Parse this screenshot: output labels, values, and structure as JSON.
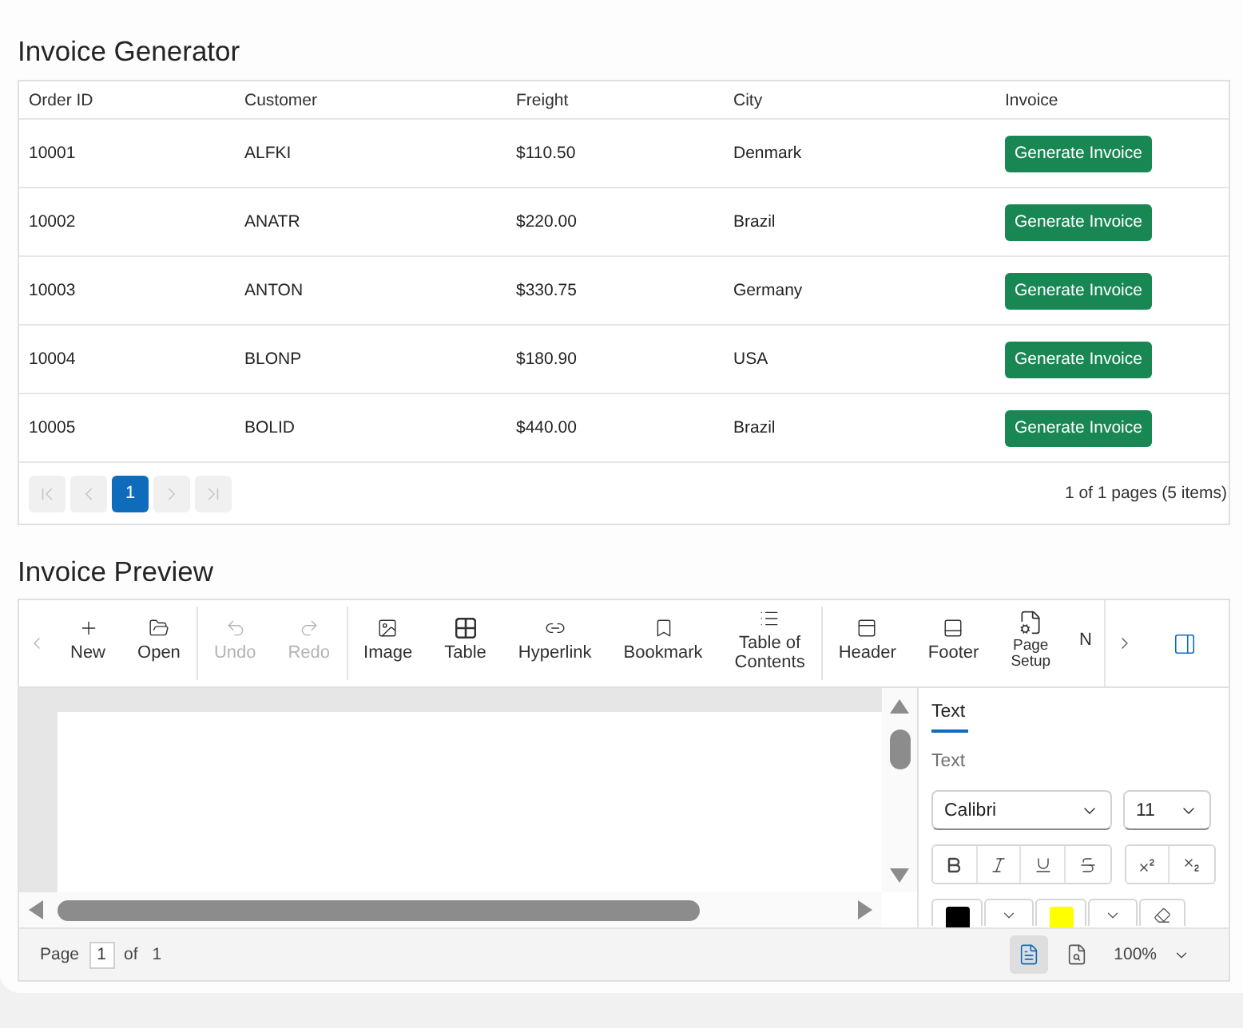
{
  "invoice_generator": {
    "title": "Invoice Generator",
    "table": {
      "columns": [
        "Order ID",
        "Customer",
        "Freight",
        "City",
        "Invoice"
      ],
      "rows": [
        {
          "cells": [
            "10001",
            "ALFKI",
            "$110.50",
            "Denmark"
          ],
          "action": "Generate Invoice"
        },
        {
          "cells": [
            "10002",
            "ANATR",
            "$220.00",
            "Brazil"
          ],
          "action": "Generate Invoice"
        },
        {
          "cells": [
            "10003",
            "ANTON",
            "$330.75",
            "Germany"
          ],
          "action": "Generate Invoice"
        },
        {
          "cells": [
            "10004",
            "BLONP",
            "$180.90",
            "USA"
          ],
          "action": "Generate Invoice"
        },
        {
          "cells": [
            "10005",
            "BOLID",
            "$440.00",
            "Brazil"
          ],
          "action": "Generate Invoice"
        }
      ]
    },
    "pager": {
      "buttons": [
        {
          "kind": "first",
          "disabled": true
        },
        {
          "kind": "prev",
          "disabled": true
        },
        {
          "kind": "page",
          "label": "1",
          "selected": true
        },
        {
          "kind": "next",
          "disabled": true
        },
        {
          "kind": "last",
          "disabled": true
        }
      ],
      "summary": "1 of 1 pages (5 items)"
    }
  },
  "invoice_preview": {
    "title": "Invoice Preview",
    "toolbar": {
      "scroll_left": {
        "disabled": true
      },
      "items": [
        {
          "kind": "new",
          "label": "New",
          "disabled": false
        },
        {
          "kind": "open",
          "label": "Open",
          "disabled": false
        },
        {
          "kind": "separator"
        },
        {
          "kind": "undo",
          "label": "Undo",
          "disabled": true
        },
        {
          "kind": "redo",
          "label": "Redo",
          "disabled": true
        },
        {
          "kind": "separator"
        },
        {
          "kind": "image",
          "label": "Image",
          "disabled": false
        },
        {
          "kind": "table",
          "label": "Table",
          "disabled": false
        },
        {
          "kind": "hyperlink",
          "label": "Hyperlink",
          "disabled": false
        },
        {
          "kind": "bookmark",
          "label": "Bookmark",
          "disabled": false
        },
        {
          "kind": "toc",
          "label": "Table of Contents",
          "disabled": false
        },
        {
          "kind": "separator"
        },
        {
          "kind": "header",
          "label": "Header",
          "disabled": false
        },
        {
          "kind": "footer",
          "label": "Footer",
          "disabled": false
        },
        {
          "kind": "page_setup",
          "label": "Page Setup",
          "disabled": false
        },
        {
          "kind": "cut",
          "label": "N",
          "disabled": false
        }
      ],
      "scroll_right": {
        "disabled": false
      }
    },
    "properties": {
      "tabs": [
        {
          "label": "Text",
          "selected": true
        }
      ],
      "section_label": "Text",
      "font_family": {
        "value": "Calibri"
      },
      "font_size": {
        "value": "11"
      },
      "format_buttons": [
        {
          "kind": "bold"
        },
        {
          "kind": "italic"
        },
        {
          "kind": "underline"
        },
        {
          "kind": "strikethrough"
        },
        {
          "kind": "superscript"
        },
        {
          "kind": "subscript"
        }
      ],
      "color_buttons": [
        {
          "kind": "font_color",
          "color": "#000000"
        },
        {
          "kind": "highlight_color",
          "color": "#ffff00"
        },
        {
          "kind": "clear_format"
        }
      ]
    },
    "status_bar": {
      "page_label": "Page",
      "page_input": "1",
      "of_label": "of",
      "page_total": "1",
      "view_buttons": [
        {
          "kind": "print_layout",
          "selected": true
        },
        {
          "kind": "web_layout",
          "selected": false
        }
      ],
      "zoom": "100%"
    }
  }
}
